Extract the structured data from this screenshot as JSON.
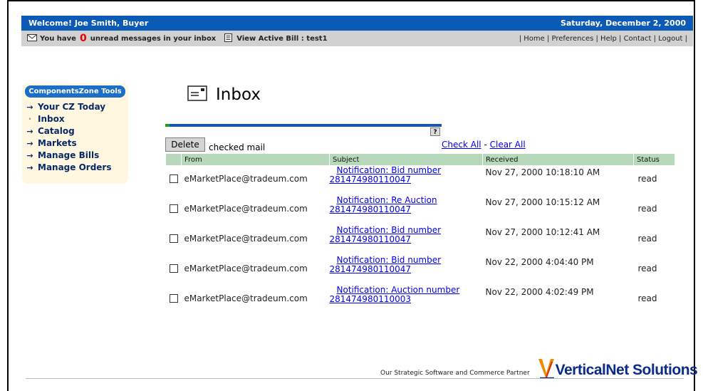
{
  "header": {
    "welcome": "Welcome! Joe Smith, Buyer",
    "date": "Saturday, December 2, 2000"
  },
  "subbar": {
    "messages_prefix": "You have",
    "unread_count": "0",
    "messages_suffix": "unread messages in your inbox",
    "view_bill": "View Active Bill : test1",
    "links": "| Home | Preferences | Help | Contact | Logout |"
  },
  "sidebar": {
    "title": "ComponentsZone Tools",
    "items": [
      {
        "label": "Your CZ Today",
        "marker": "→"
      },
      {
        "label": "Inbox",
        "marker": "·"
      },
      {
        "label": "Catalog",
        "marker": "→"
      },
      {
        "label": "Markets",
        "marker": "→"
      },
      {
        "label": "Manage Bills",
        "marker": "→"
      },
      {
        "label": "Manage Orders",
        "marker": "→"
      }
    ]
  },
  "inbox": {
    "title": "Inbox",
    "help": "?",
    "delete_label": "Delete",
    "checked_mail": "checked mail",
    "check_all": "Check All",
    "separator": "-",
    "clear_all": "Clear All",
    "columns": [
      "From",
      "Subject",
      "Received",
      "Status"
    ],
    "rows": [
      {
        "from": "eMarketPlace@tradeum.com",
        "subject1": "Notification: Bid number",
        "subject2": "281474980110047",
        "received": "Nov 27, 2000 10:18:10 AM",
        "status": "read"
      },
      {
        "from": "eMarketPlace@tradeum.com",
        "subject1": "Notification: Re Auction",
        "subject2": "281474980110047",
        "received": "Nov 27, 2000 10:15:12 AM",
        "status": "read"
      },
      {
        "from": "eMarketPlace@tradeum.com",
        "subject1": "Notification: Bid number",
        "subject2": "281474980110047",
        "received": "Nov 27, 2000 10:12:41 AM",
        "status": "read"
      },
      {
        "from": "eMarketPlace@tradeum.com",
        "subject1": "Notification: Bid number",
        "subject2": "281474980110047",
        "received": "Nov 22, 2000 4:04:40 PM",
        "status": "read"
      },
      {
        "from": "eMarketPlace@tradeum.com",
        "subject1": "Notification: Auction number",
        "subject2": "281474980110003",
        "received": "Nov 22, 2000 4:02:49 PM",
        "status": "read"
      }
    ]
  },
  "footer": {
    "tagline": "Our Strategic Software and Commerce Partner",
    "logo_text": "VerticalNet Solutions"
  },
  "colors": {
    "topbar": "#0a5ab6",
    "subbar": "#d1d1d1",
    "unread_count": "#e20000",
    "sidebar_bg": "#fff7df",
    "sidebar_head": "#1c6fc8",
    "table_header": "#b8d8bc",
    "link": "#0000ee"
  },
  "icons": {
    "messages": "envelope-icon",
    "bill": "document-icon",
    "inbox": "inbox-letter-icon",
    "help": "help-icon",
    "logo": "verticalnet-v-logo"
  }
}
